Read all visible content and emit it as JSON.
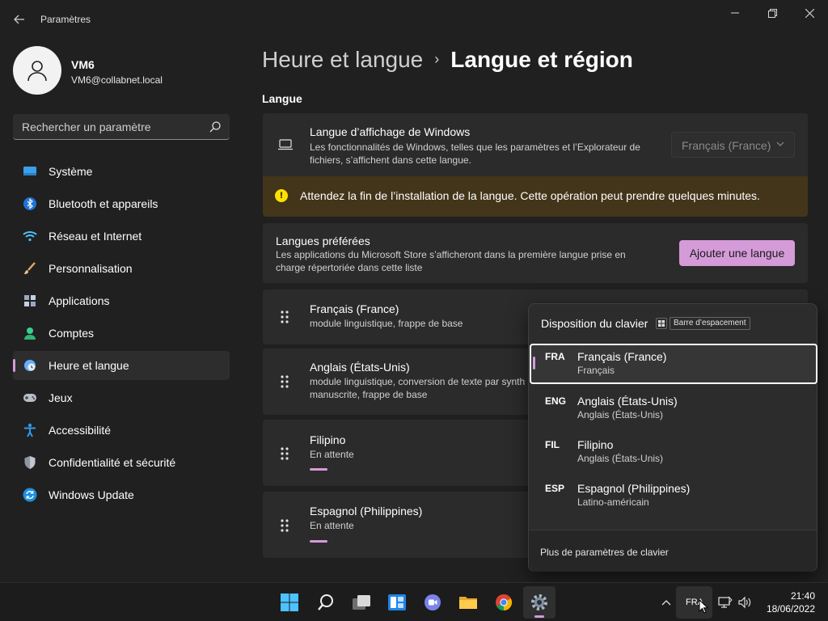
{
  "window": {
    "title": "Paramètres",
    "controls": {
      "minimize": "minimize-icon",
      "maximize": "maximize-icon",
      "close": "close-icon"
    }
  },
  "profile": {
    "name": "VM6",
    "email": "VM6@collabnet.local"
  },
  "search": {
    "placeholder": "Rechercher un paramètre"
  },
  "sidebar": {
    "items": [
      {
        "label": "Système",
        "icon": "system-icon"
      },
      {
        "label": "Bluetooth et appareils",
        "icon": "bluetooth-icon"
      },
      {
        "label": "Réseau et Internet",
        "icon": "wifi-icon"
      },
      {
        "label": "Personnalisation",
        "icon": "brush-icon"
      },
      {
        "label": "Applications",
        "icon": "apps-icon"
      },
      {
        "label": "Comptes",
        "icon": "account-icon"
      },
      {
        "label": "Heure et langue",
        "icon": "time-language-icon",
        "active": true
      },
      {
        "label": "Jeux",
        "icon": "gamepad-icon"
      },
      {
        "label": "Accessibilité",
        "icon": "accessibility-icon"
      },
      {
        "label": "Confidentialité et sécurité",
        "icon": "shield-icon"
      },
      {
        "label": "Windows Update",
        "icon": "update-icon"
      }
    ]
  },
  "main": {
    "breadcrumb": {
      "parent": "Heure et langue",
      "separator": "›",
      "current": "Langue et région"
    },
    "section_title": "Langue",
    "display_language": {
      "title": "Langue d’affichage de Windows",
      "description_line1": "Les fonctionnalités de Windows, telles que les paramètres et l’Explorateur de",
      "description_line2": "fichiers, s’affichent dans cette langue.",
      "dropdown_value": "Français (France)"
    },
    "warning": {
      "text": "Attendez la fin de l’installation de la langue. Cette opération peut prendre quelques minutes."
    },
    "preferred": {
      "title": "Langues préférées",
      "description_line1": "Les applications du Microsoft Store s’afficheront dans la première langue prise en",
      "description_line2": "charge répertoriée dans cette liste",
      "add_button": "Ajouter une langue"
    },
    "languages": [
      {
        "name": "Français (France)",
        "detail_line1": "module linguistique, frappe de base",
        "detail_line2": ""
      },
      {
        "name": "Anglais (États-Unis)",
        "detail_line1": "module linguistique, conversion de texte par synth",
        "detail_line2": "manuscrite, frappe de base"
      },
      {
        "name": "Filipino",
        "detail_line1": "En attente",
        "detail_line2": ""
      },
      {
        "name": "Espagnol (Philippines)",
        "detail_line1": "En attente",
        "detail_line2": ""
      }
    ]
  },
  "keyboard_flyout": {
    "title": "Disposition du clavier",
    "shortcut_label": "Barre d’espacement",
    "items": [
      {
        "code": "FRA",
        "name": "Français (France)",
        "sub": "Français",
        "selected": true
      },
      {
        "code": "ENG",
        "name": "Anglais (États-Unis)",
        "sub": "Anglais (États-Unis)"
      },
      {
        "code": "FIL",
        "name": "Filipino",
        "sub": "Anglais (États-Unis)"
      },
      {
        "code": "ESP",
        "name": "Espagnol (Philippines)",
        "sub": "Latino-américain"
      }
    ],
    "footer_link": "Plus de paramètres de clavier"
  },
  "taskbar": {
    "apps": [
      "start-icon",
      "search-icon",
      "task-view-icon",
      "widgets-icon",
      "teams-chat-icon",
      "file-explorer-icon",
      "chrome-icon",
      "settings-icon"
    ],
    "tray_language": "FRA",
    "time": "21:40",
    "date": "18/06/2022"
  },
  "colors": {
    "accent": "#d59bd9",
    "warning_bg": "#433519",
    "warning_icon": "#fce100",
    "background": "#202020",
    "card": "#2b2b2b"
  }
}
